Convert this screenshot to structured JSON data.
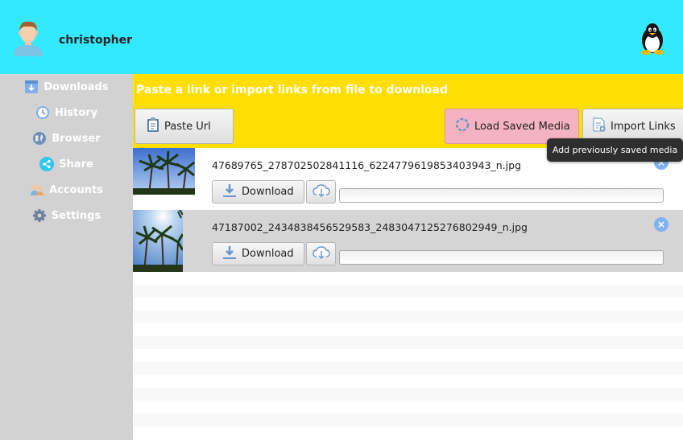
{
  "header": {
    "username": "christopher"
  },
  "sidebar": {
    "items": [
      {
        "label": "Downloads",
        "icon": "downloads-icon"
      },
      {
        "label": "History",
        "icon": "clock-icon"
      },
      {
        "label": "Browser",
        "icon": "globe-icon"
      },
      {
        "label": "Share",
        "icon": "share-icon"
      },
      {
        "label": "Accounts",
        "icon": "accounts-icon"
      },
      {
        "label": "Settings",
        "icon": "gear-icon"
      }
    ]
  },
  "toolbar": {
    "title": "Paste a link or import links from file to download",
    "paste_label": "Paste Url",
    "load_label": "Load Saved Media",
    "import_label": "Import Links"
  },
  "tooltip": {
    "text": "Add previously saved media"
  },
  "downloads": [
    {
      "filename": "47689765_278702502841116_6224779619853403943_n.jpg",
      "button": "Download",
      "progress": 0
    },
    {
      "filename": "47187002_2434838456529583_2483047125276802949_n.jpg",
      "button": "Download",
      "progress": 0
    }
  ],
  "colors": {
    "header_bg": "#33e9ff",
    "toolbar_bg": "#ffde00",
    "sidebar_bg": "#d2d2d2",
    "load_button_bg": "#f4b3c3"
  }
}
